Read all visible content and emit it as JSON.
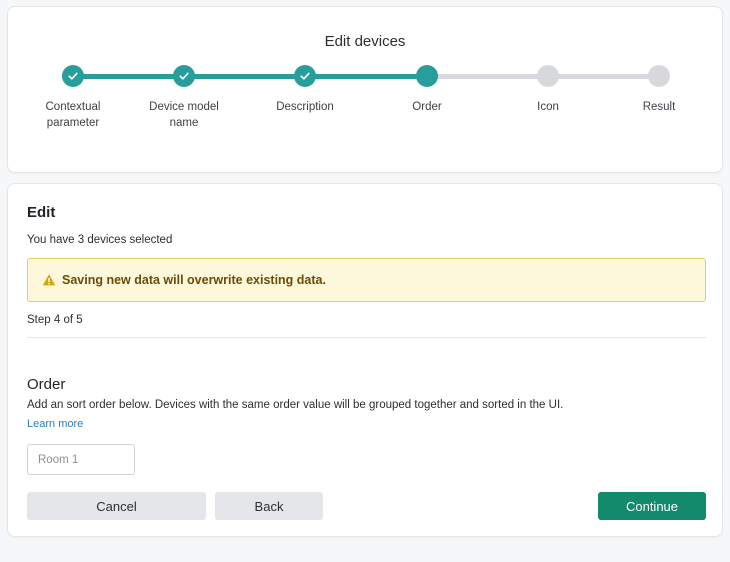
{
  "wizard": {
    "title": "Edit devices",
    "colors": {
      "done": "#279e9c",
      "todo": "#d6d8dc"
    },
    "steps": [
      {
        "label": "Contextual parameter",
        "state": "done",
        "icon": "check-icon"
      },
      {
        "label": "Device model name",
        "state": "done",
        "icon": "check-icon"
      },
      {
        "label": "Description",
        "state": "done",
        "icon": "check-icon"
      },
      {
        "label": "Order",
        "state": "current"
      },
      {
        "label": "Icon",
        "state": "todo"
      },
      {
        "label": "Result",
        "state": "todo"
      }
    ]
  },
  "edit": {
    "heading": "Edit",
    "selected_text": "You have 3 devices selected",
    "warning": {
      "icon": "warning-icon",
      "text": "Saving new data will overwrite existing data.",
      "color": "#fdf8db"
    },
    "step_counter": "Step 4 of 5",
    "order": {
      "heading": "Order",
      "description": "Add an sort order below. Devices with the same order value will be grouped together and sorted in the UI.",
      "learn_more": "Learn more",
      "input_placeholder": "Room 1",
      "input_value": ""
    },
    "buttons": {
      "cancel": "Cancel",
      "back": "Back",
      "continue": "Continue"
    },
    "accent_color": "#128a6b"
  }
}
